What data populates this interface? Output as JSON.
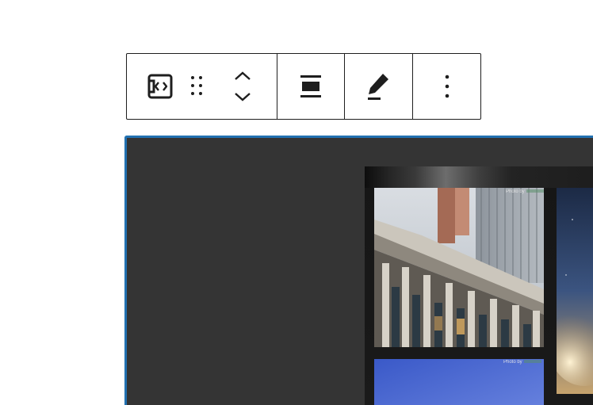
{
  "toolbar": {
    "embed_icon": "embed-code-icon",
    "drag_icon": "drag-handle-icon",
    "move_up_icon": "chevron-up-icon",
    "move_down_icon": "chevron-down-icon",
    "align_icon": "align-wide-icon",
    "edit_icon": "pencil-icon",
    "options_icon": "more-vertical-icon"
  },
  "embed": {
    "photos": [
      {
        "credit_prefix": "Photo by"
      },
      {
        "credit_prefix": "Photo by"
      }
    ]
  },
  "colors": {
    "toolbar_border": "#1e1e1e",
    "selection_outline": "#2271b1",
    "block_background": "#343434"
  }
}
